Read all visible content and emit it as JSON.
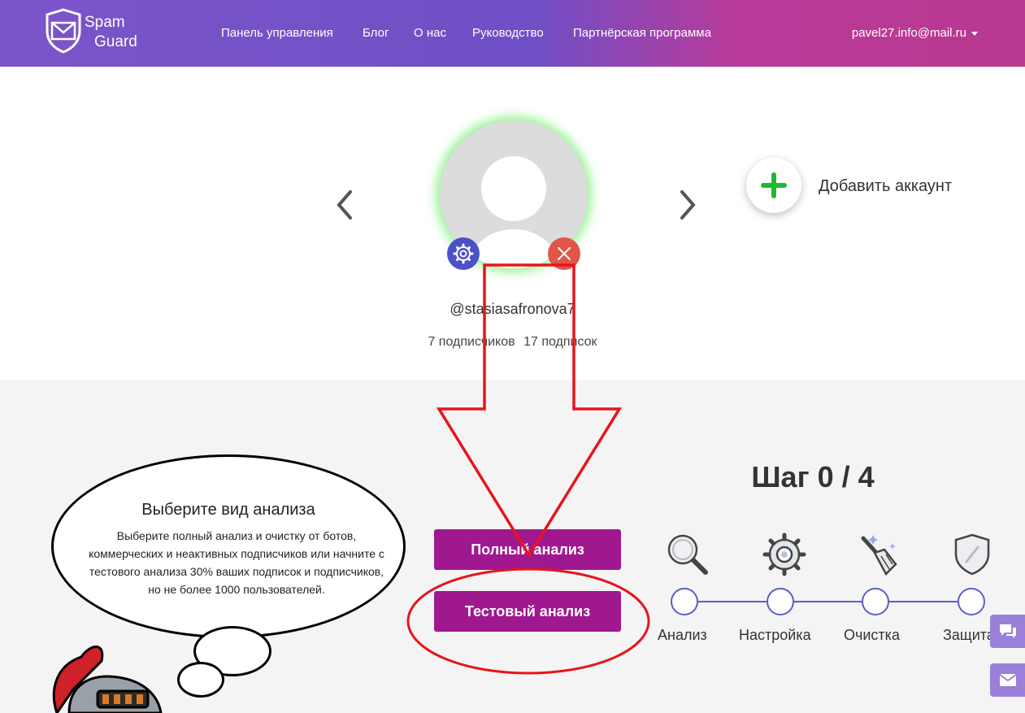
{
  "header": {
    "logo_line1": "Spam",
    "logo_line2": "Guard",
    "nav": [
      "Панель управления",
      "Блог",
      "О нас",
      "Руководство",
      "Партнёрская программа"
    ],
    "user_email": "pavel27.info@mail.ru"
  },
  "profile": {
    "username": "@stasiasafronova7",
    "followers": "7 подписчиков",
    "following": "17 подписок",
    "add_account_label": "Добавить аккаунт"
  },
  "analysis": {
    "bubble_title": "Выберите вид анализа",
    "bubble_text": "Выберите полный анализ и очистку от ботов, коммерческих и неактивных подписчиков или начните с тестового анализа 30% ваших подписок и подписчиков, но не более 1000 пользователей.",
    "full_button": "Полный анализ",
    "test_button": "Тестовый анализ"
  },
  "steps": {
    "title": "Шаг 0 / 4",
    "labels": [
      "Анализ",
      "Настройка",
      "Очистка",
      "Защита"
    ]
  },
  "colors": {
    "accent": "#a01890",
    "step_line": "#5a5fc8",
    "annotation": "#e8141c",
    "add_plus": "#1fb832"
  }
}
